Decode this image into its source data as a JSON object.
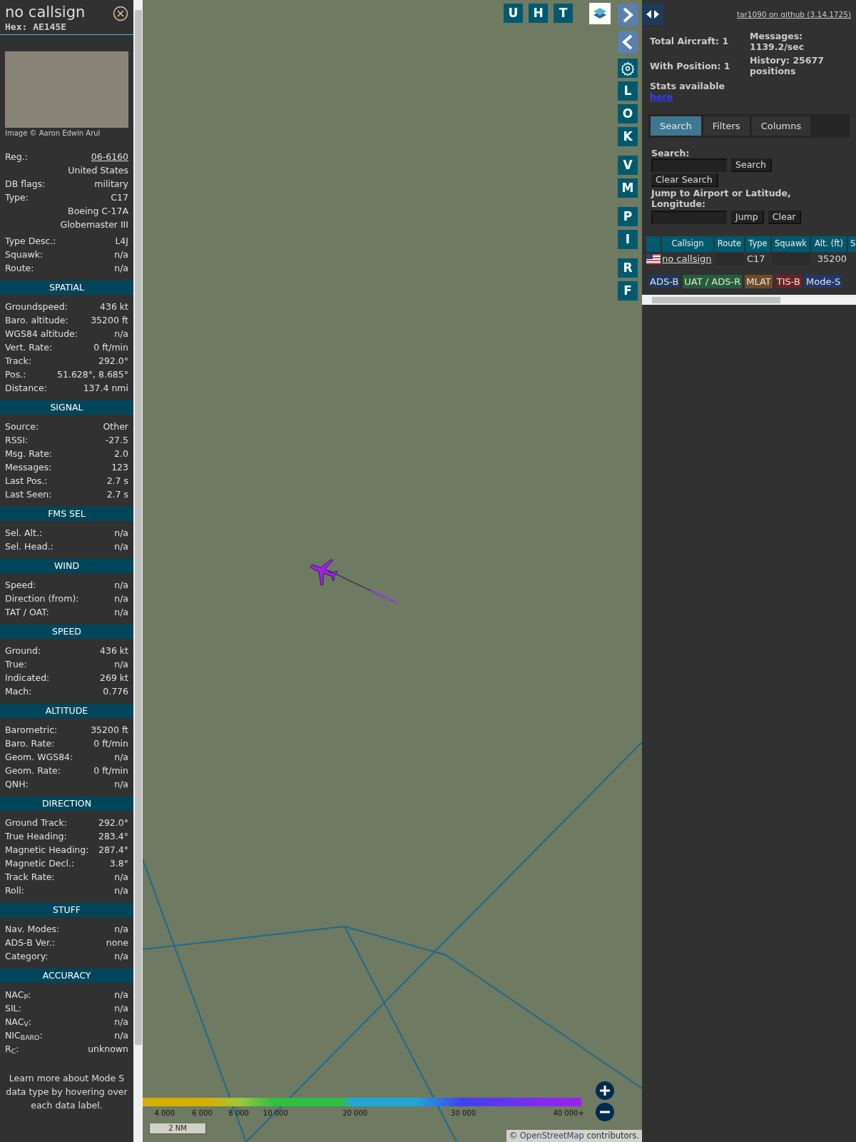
{
  "aircraft": {
    "callsign": "no callsign",
    "hex": "Hex: AE145E",
    "photo_credit": "Image © Aaron Edwin Arul"
  },
  "info_rows": [
    {
      "label": "Reg.:",
      "value": "06-6160",
      "kind": "link"
    },
    {
      "value": "United States",
      "kind": "plain"
    },
    {
      "label": "DB flags:",
      "value": "military",
      "kind": "plain"
    },
    {
      "label": "Type:",
      "value": "C17",
      "kind": "plain"
    },
    {
      "value": "Boeing C-17A Globemaster III",
      "kind": "plain"
    },
    {
      "label": "Type Desc.:",
      "value": "L4J",
      "kind": "plain"
    },
    {
      "label": "Squawk:",
      "value": "n/a",
      "kind": "plain"
    },
    {
      "label": "Route:",
      "value": "n/a",
      "kind": "plain"
    }
  ],
  "sections": [
    {
      "title": "SPATIAL",
      "rows": [
        {
          "label": "Groundspeed:",
          "value": "436 kt"
        },
        {
          "label": "Baro. altitude:",
          "value": "35200 ft"
        },
        {
          "label": "WGS84 altitude:",
          "value": "n/a"
        },
        {
          "label": "Vert. Rate:",
          "value": "0 ft/min"
        },
        {
          "label": "Track:",
          "value": "292.0°"
        },
        {
          "label": "Pos.:",
          "value": "51.628°, 8.685°"
        },
        {
          "label": "Distance:",
          "value": "137.4 nmi"
        }
      ]
    },
    {
      "title": "SIGNAL",
      "rows": [
        {
          "label": "Source:",
          "value": "Other"
        },
        {
          "label": "RSSI:",
          "value": "-27.5"
        },
        {
          "label": "Msg. Rate:",
          "value": "2.0"
        },
        {
          "label": "Messages:",
          "value": "123"
        },
        {
          "label": "Last Pos.:",
          "value": "2.7 s"
        },
        {
          "label": "Last Seen:",
          "value": "2.7 s"
        }
      ]
    },
    {
      "title": "FMS SEL",
      "rows": [
        {
          "label": "Sel. Alt.:",
          "value": "n/a"
        },
        {
          "label": "Sel. Head.:",
          "value": "n/a"
        }
      ]
    },
    {
      "title": "WIND",
      "rows": [
        {
          "label": "Speed:",
          "value": "n/a"
        },
        {
          "label": "Direction (from):",
          "value": "n/a"
        },
        {
          "label": "TAT / OAT:",
          "value": "n/a"
        }
      ]
    },
    {
      "title": "SPEED",
      "rows": [
        {
          "label": "Ground:",
          "value": "436 kt"
        },
        {
          "label": "True:",
          "value": "n/a"
        },
        {
          "label": "Indicated:",
          "value": "269 kt"
        },
        {
          "label": "Mach:",
          "value": "0.776"
        }
      ]
    },
    {
      "title": "ALTITUDE",
      "rows": [
        {
          "label": "Barometric:",
          "value": "35200 ft"
        },
        {
          "label": "Baro. Rate:",
          "value": "0 ft/min"
        },
        {
          "label": "Geom. WGS84:",
          "value": "n/a"
        },
        {
          "label": "Geom. Rate:",
          "value": "0 ft/min"
        },
        {
          "label": "QNH:",
          "value": "n/a"
        }
      ]
    },
    {
      "title": "DIRECTION",
      "rows": [
        {
          "label": "Ground Track:",
          "value": "292.0°"
        },
        {
          "label": "True Heading:",
          "value": "283.4°"
        },
        {
          "label": "Magnetic Heading:",
          "value": "287.4°"
        },
        {
          "label": "Magnetic Decl.:",
          "value": "3.8°"
        },
        {
          "label": "Track Rate:",
          "value": "n/a"
        },
        {
          "label": "Roll:",
          "value": "n/a"
        }
      ]
    },
    {
      "title": "STUFF",
      "rows": [
        {
          "label": "Nav. Modes:",
          "value": "n/a"
        },
        {
          "label": "ADS-B Ver.:",
          "value": "none"
        },
        {
          "label": "Category:",
          "value": "n/a"
        }
      ]
    },
    {
      "title": "ACCURACY",
      "rows": [
        {
          "label": "NAC$_{P}$:",
          "value": "n/a"
        },
        {
          "label": "SIL:",
          "value": "n/a"
        },
        {
          "label": "NAC$_{V}$:",
          "value": "n/a"
        },
        {
          "label": "NIC$_{BARO}$:",
          "value": "n/a"
        },
        {
          "label": "R$_{C}$:",
          "value": "unknown"
        }
      ]
    }
  ],
  "help_text": "Learn more about Mode S data type by hovering over each data label.",
  "map": {
    "top_buttons": [
      "U",
      "H",
      "T"
    ],
    "side_buttons": [
      {
        "kind": "next"
      },
      {
        "kind": "prev"
      },
      {
        "kind": "settings"
      },
      {
        "kind": "letter",
        "label": "L"
      },
      {
        "kind": "letter",
        "label": "O"
      },
      {
        "kind": "letter",
        "label": "K"
      },
      {
        "kind": "letter",
        "label": "V"
      },
      {
        "kind": "letter",
        "label": "M"
      },
      {
        "kind": "letter",
        "label": "P"
      },
      {
        "kind": "letter",
        "label": "I"
      },
      {
        "kind": "letter",
        "label": "R"
      },
      {
        "kind": "letter",
        "label": "F"
      }
    ],
    "altitude_legend": [
      "4 000",
      "6 000",
      "8 000",
      "10 000",
      "20 000",
      "30 000",
      "40 000+"
    ],
    "scale": "2 NM",
    "attribution": {
      "prefix": "©",
      "link": "OpenStreetMap",
      "suffix": "contributors."
    }
  },
  "sidebar": {
    "github_link": "tar1090 on github (3.14.1725)",
    "stats": {
      "total": "Total Aircraft: 1",
      "with_position": "With Position: 1",
      "messages": "Messages: 1139.2/sec",
      "history": "History: 25677 positions",
      "stats_label": "Stats available",
      "stats_link": "here"
    },
    "tabs": [
      {
        "label": "Search",
        "selected": true
      },
      {
        "label": "Filters",
        "selected": false
      },
      {
        "label": "Columns",
        "selected": false
      }
    ],
    "search_label": "Search:",
    "search_button": "Search",
    "clear_search": "Clear Search",
    "jump_label": "Jump to Airport or Latitude, Longitude:",
    "jump_button": "Jump",
    "clear_button": "Clear",
    "table": {
      "columns": [
        "Callsign",
        "Route",
        "Type",
        "Squawk",
        "Alt. (ft)",
        "S"
      ],
      "rows": [
        {
          "callsign": "no callsign",
          "type": "C17",
          "altitude": "35200"
        }
      ]
    },
    "source_tags": [
      {
        "label": "ADS-B",
        "color": "#1d3a5c"
      },
      {
        "label": "UAT / ADS-R",
        "color": "#245e36"
      },
      {
        "label": "MLAT",
        "color": "#6e4c26"
      },
      {
        "label": "TIS-B",
        "color": "#6a2424"
      },
      {
        "label": "Mode-S",
        "color": "#22386a"
      }
    ]
  }
}
